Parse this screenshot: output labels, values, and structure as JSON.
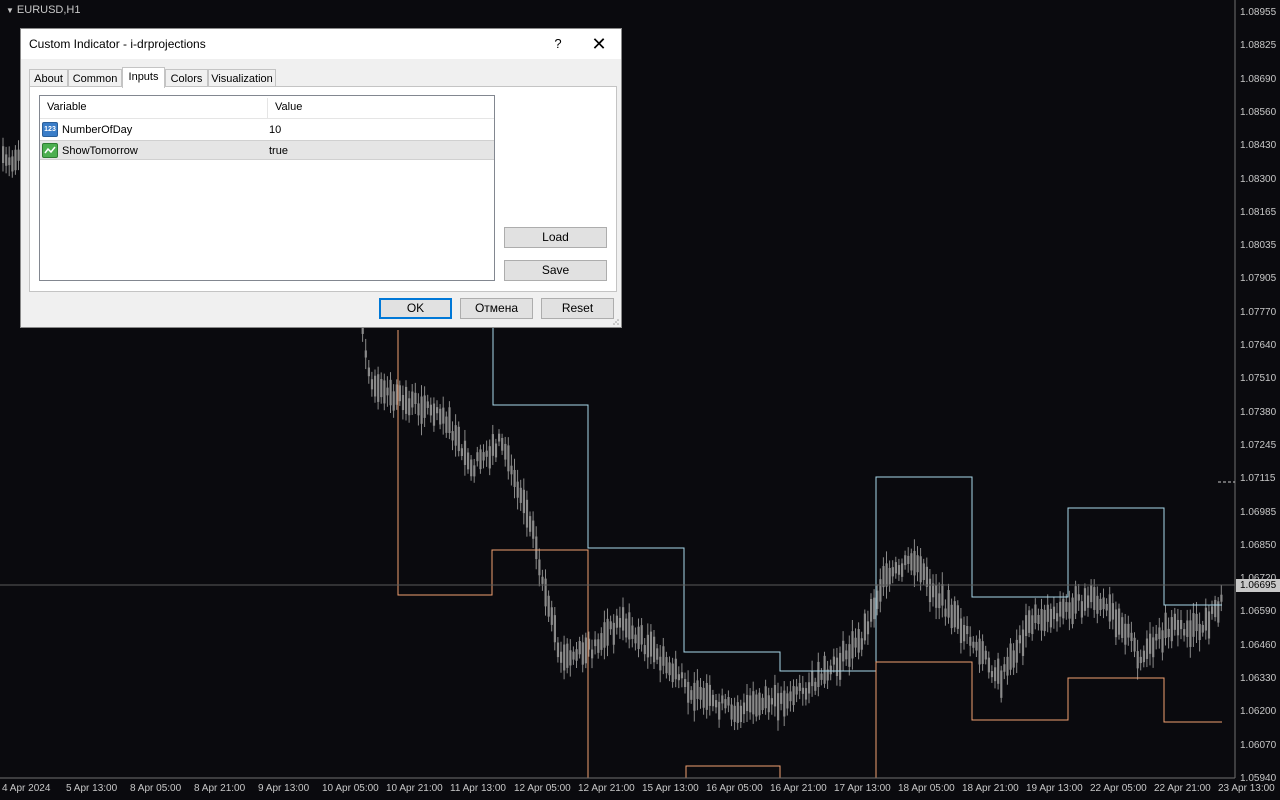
{
  "chart": {
    "symbol": "EURUSD,H1",
    "current_price": "1.06695",
    "price_axis": [
      "1.08955",
      "1.08825",
      "1.08690",
      "1.08560",
      "1.08430",
      "1.08300",
      "1.08165",
      "1.08035",
      "1.07905",
      "1.07770",
      "1.07640",
      "1.07510",
      "1.07380",
      "1.07245",
      "1.07115",
      "1.06985",
      "1.06850",
      "1.06720",
      "1.06590",
      "1.06460",
      "1.06330",
      "1.06200",
      "1.06070",
      "1.05940"
    ],
    "time_axis": [
      "4 Apr 2024",
      "5 Apr 13:00",
      "8 Apr 05:00",
      "8 Apr 21:00",
      "9 Apr 13:00",
      "10 Apr 05:00",
      "10 Apr 21:00",
      "11 Apr 13:00",
      "12 Apr 05:00",
      "12 Apr 21:00",
      "15 Apr 13:00",
      "16 Apr 05:00",
      "16 Apr 21:00",
      "17 Apr 13:00",
      "18 Apr 05:00",
      "18 Apr 21:00",
      "19 Apr 13:00",
      "22 Apr 05:00",
      "22 Apr 21:00",
      "23 Apr 13:00"
    ],
    "colors": {
      "background": "#0a0a0e",
      "upper_line": "#a8d8ea",
      "lower_line": "#f0a070",
      "candles": "#8a8a8a",
      "axis_text": "#c8c8c8"
    }
  },
  "dialog": {
    "title": "Custom Indicator - i-drprojections",
    "help_label": "?",
    "close_label": "✕",
    "tabs": [
      "About",
      "Common",
      "Inputs",
      "Colors",
      "Visualization"
    ],
    "active_tab": "Inputs",
    "table": {
      "headers": [
        "Variable",
        "Value"
      ],
      "rows": [
        {
          "variable": "NumberOfDay",
          "value": "10",
          "icon": "integer-icon"
        },
        {
          "variable": "ShowTomorrow",
          "value": "true",
          "icon": "boolean-icon"
        }
      ]
    },
    "buttons": {
      "load": "Load",
      "save": "Save",
      "ok": "OK",
      "cancel": "Отмена",
      "reset": "Reset"
    }
  }
}
